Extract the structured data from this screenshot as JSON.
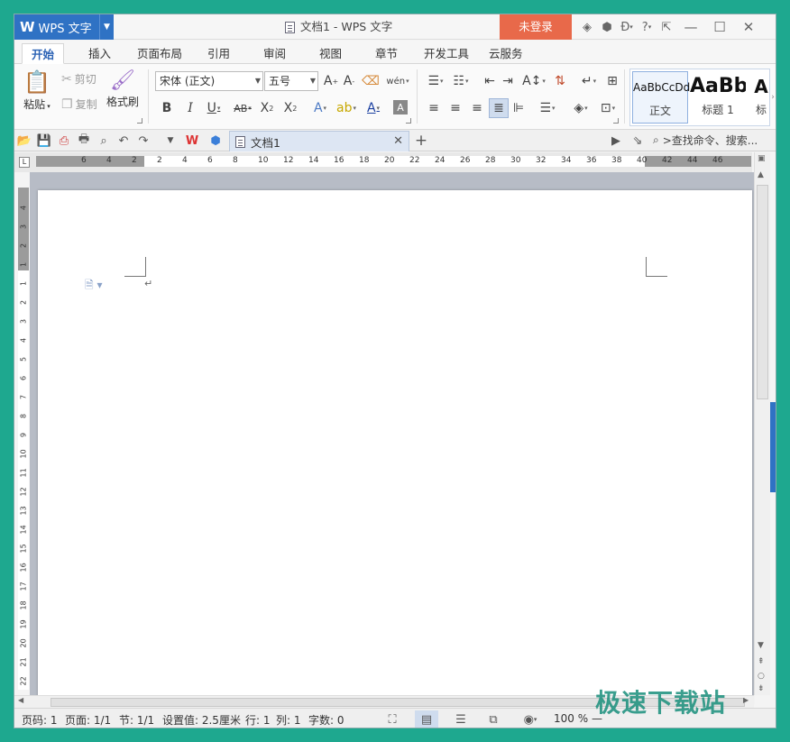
{
  "app": {
    "name": "WPS 文字",
    "logo": "W"
  },
  "title": {
    "text": "文档1 - WPS 文字"
  },
  "login_label": "未登录",
  "menu_tabs": [
    "开始",
    "插入",
    "页面布局",
    "引用",
    "审阅",
    "视图",
    "章节",
    "开发工具",
    "云服务"
  ],
  "clipboard": {
    "paste": "粘贴",
    "cut": "剪切",
    "copy": "复制",
    "format_painter": "格式刷"
  },
  "font": {
    "family": "宋体 (正文)",
    "size": "五号"
  },
  "styles": [
    {
      "sample": "AaBbCcDd",
      "name": "正文"
    },
    {
      "sample": "AaBb",
      "name": "标题 1"
    },
    {
      "sample": "A",
      "name": "标"
    }
  ],
  "doc_tab": {
    "label": "文档1"
  },
  "search": {
    "placeholder": ">查找命令、搜索..."
  },
  "ruler": {
    "h_ticks": [
      "6",
      "4",
      "2",
      "2",
      "4",
      "6",
      "8",
      "10",
      "12",
      "14",
      "16",
      "18",
      "20",
      "22",
      "24",
      "26",
      "28",
      "30",
      "32",
      "34",
      "36",
      "38",
      "40",
      "42",
      "44",
      "46"
    ],
    "v_ticks": [
      "4",
      "3",
      "2",
      "1",
      "1",
      "2",
      "3",
      "4",
      "5",
      "6",
      "7",
      "8",
      "9",
      "10",
      "11",
      "12",
      "13",
      "14",
      "15",
      "16",
      "17",
      "18",
      "19",
      "20",
      "21",
      "22"
    ]
  },
  "status": {
    "page_num": "页码: 1",
    "pages": "页面: 1/1",
    "section": "节: 1/1",
    "setting": "设置值: 2.5厘米",
    "row": "行: 1",
    "col": "列: 1",
    "word_count": "字数: 0",
    "zoom": "100 %"
  },
  "watermark": "极速下载站"
}
